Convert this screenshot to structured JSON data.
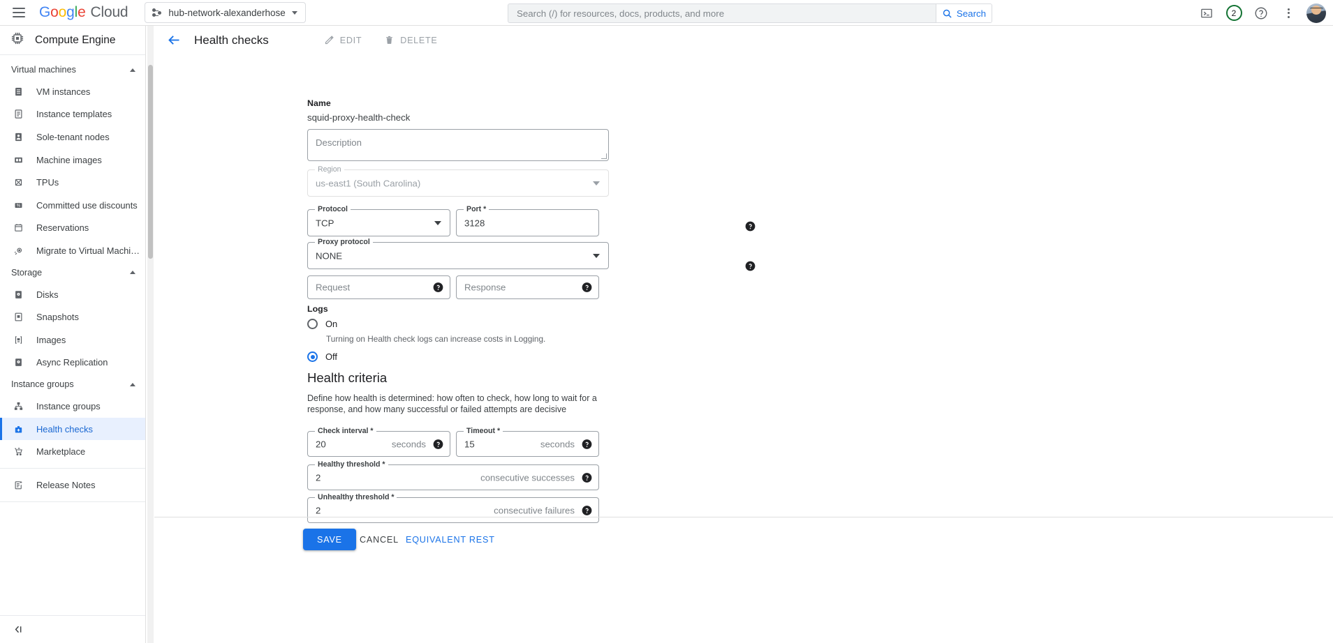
{
  "topbar": {
    "menu_icon": "hamburger-icon",
    "brand": {
      "google": "Google",
      "cloud": "Cloud"
    },
    "project": {
      "name": "hub-network-alexanderhose",
      "icon": "project-nodes-icon"
    },
    "search": {
      "placeholder": "Search (/) for resources, docs, products, and more",
      "value": "",
      "button_label": "Search",
      "icon": "search-icon"
    },
    "actions": {
      "cloud_shell_icon": "terminal-icon",
      "notifications_count": "2",
      "notifications_color": "#137333",
      "help_icon": "help-circle-icon",
      "more_icon": "kebab-menu-icon",
      "avatar_icon": "user-avatar"
    }
  },
  "sidebar": {
    "product": {
      "title": "Compute Engine",
      "icon": "cpu-chip-icon"
    },
    "groups": [
      {
        "label": "Virtual machines",
        "expanded": true
      },
      {
        "label": "Storage",
        "expanded": true
      },
      {
        "label": "Instance groups",
        "expanded": true
      }
    ],
    "items": [
      {
        "label": "VM instances",
        "icon": "vm-instance-icon"
      },
      {
        "label": "Instance templates",
        "icon": "instance-template-icon"
      },
      {
        "label": "Sole-tenant nodes",
        "icon": "sole-tenant-node-icon"
      },
      {
        "label": "Machine images",
        "icon": "machine-image-icon"
      },
      {
        "label": "TPUs",
        "icon": "tpu-icon"
      },
      {
        "label": "Committed use discounts",
        "icon": "percent-icon"
      },
      {
        "label": "Reservations",
        "icon": "calendar-icon"
      },
      {
        "label": "Migrate to Virtual Machin…",
        "icon": "migrate-icon"
      },
      {
        "label": "Disks",
        "icon": "disk-icon"
      },
      {
        "label": "Snapshots",
        "icon": "snapshot-icon"
      },
      {
        "label": "Images",
        "icon": "image-icon"
      },
      {
        "label": "Async Replication",
        "icon": "async-replication-icon"
      },
      {
        "label": "Instance groups",
        "icon": "instance-group-icon"
      },
      {
        "label": "Health checks",
        "icon": "health-check-icon",
        "selected": true
      },
      {
        "label": "Marketplace",
        "icon": "marketplace-cart-icon"
      },
      {
        "label": "Release Notes",
        "icon": "release-notes-icon"
      }
    ],
    "collapse": {
      "icon": "collapse-panel-icon"
    }
  },
  "page": {
    "back_icon": "back-arrow-icon",
    "title": "Health checks",
    "edit_label": "EDIT",
    "edit_icon": "pencil-icon",
    "delete_label": "DELETE",
    "delete_icon": "trash-icon"
  },
  "form": {
    "name_label": "Name",
    "name_value": "squid-proxy-health-check",
    "description": {
      "label": "Description",
      "value": "",
      "placeholder": "Description"
    },
    "region": {
      "label": "Region",
      "value": "us-east1 (South Carolina)",
      "disabled": true
    },
    "protocol": {
      "label": "Protocol",
      "value": "TCP"
    },
    "port": {
      "label": "Port *",
      "value": "3128"
    },
    "proxy_protocol": {
      "label": "Proxy protocol",
      "value": "NONE"
    },
    "request": {
      "label": "Request",
      "value": "",
      "placeholder": "Request"
    },
    "response": {
      "label": "Response",
      "value": "",
      "placeholder": "Response"
    },
    "logs": {
      "label": "Logs",
      "on_label": "On",
      "on_hint": "Turning on Health check logs can increase costs in Logging.",
      "off_label": "Off",
      "selected": "Off"
    }
  },
  "health_criteria": {
    "title": "Health criteria",
    "description": "Define how health is determined: how often to check, how long to wait for a response, and how many successful or failed attempts are decisive",
    "check_interval": {
      "label": "Check interval *",
      "value": "20",
      "suffix": "seconds"
    },
    "timeout": {
      "label": "Timeout *",
      "value": "15",
      "suffix": "seconds"
    },
    "healthy_threshold": {
      "label": "Healthy threshold *",
      "value": "2",
      "suffix": "consecutive successes"
    },
    "unhealthy_threshold": {
      "label": "Unhealthy threshold *",
      "value": "2",
      "suffix": "consecutive failures"
    }
  },
  "footer": {
    "save_label": "SAVE",
    "cancel_label": "CANCEL",
    "rest_label": "EQUIVALENT REST"
  },
  "colors": {
    "accent": "#1a73e8",
    "selected_bg": "#e8f0fe",
    "selected_text": "#1967d2",
    "text": "#3c4043"
  }
}
